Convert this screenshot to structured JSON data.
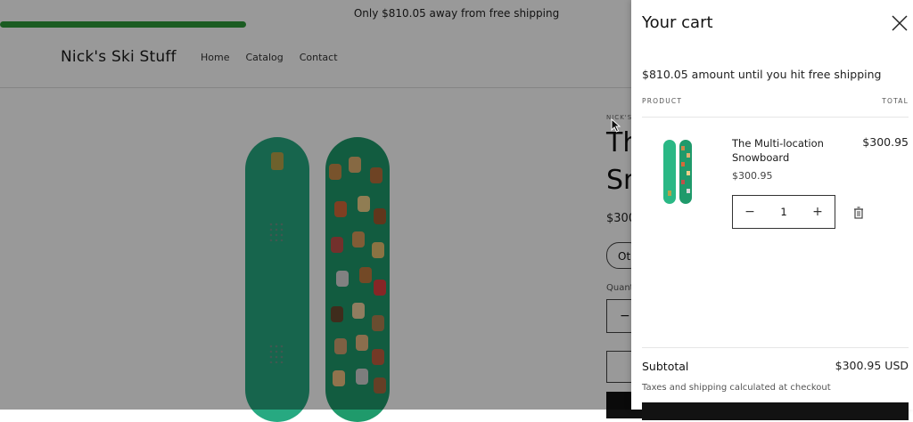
{
  "announcement": {
    "text": "Only $810.05 away from free shipping",
    "progress_fraction": 0.27
  },
  "store": {
    "name": "Nick's Ski Stuff",
    "nav": [
      "Home",
      "Catalog",
      "Contact"
    ]
  },
  "product_page": {
    "vendor": "NICK'S",
    "title_line1": "Th",
    "title_line2": "Sn",
    "price": "$300",
    "variant_text": "Ot",
    "quantity_label": "Quant",
    "quantity_minus": "−"
  },
  "cart": {
    "title": "Your cart",
    "shipping_message": "$810.05 amount until you hit free shipping",
    "col_product": "PRODUCT",
    "col_total": "TOTAL",
    "items": [
      {
        "name": "The Multi-location Snowboard",
        "unit_price": "$300.95",
        "line_total": "$300.95",
        "quantity": "1"
      }
    ],
    "qty_minus": "−",
    "qty_plus": "+",
    "subtotal_label": "Subtotal",
    "subtotal_value": "$300.95 USD",
    "tax_note": "Taxes and shipping calculated at checkout"
  },
  "colors": {
    "accent_green": "#2d9a3a",
    "board_green": "#27a981",
    "dark": "#121212"
  },
  "icons": {
    "close": "close-icon",
    "trash": "trash-icon",
    "cursor": "mouse-cursor-icon"
  }
}
